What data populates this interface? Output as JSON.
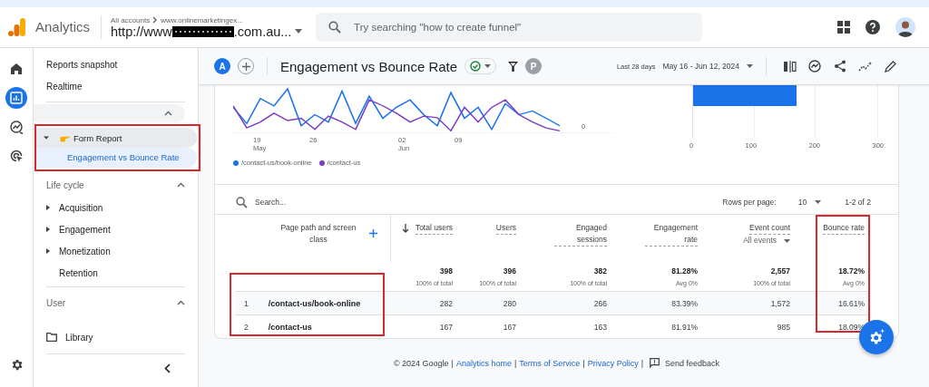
{
  "topbar": {
    "logo_text": "Analytics",
    "breadcrumb": [
      "All accounts",
      "www.onlinemarketingex..."
    ],
    "property": {
      "prefix": "http://www",
      "redacted": true,
      "suffix": ".com.au..."
    },
    "search": {
      "placeholder": "Try searching \"how to create funnel\""
    }
  },
  "rail": [
    {
      "selected": false
    },
    {
      "selected": true
    },
    {
      "selected": false
    },
    {
      "selected": false
    }
  ],
  "sidebar": {
    "top_items": [
      "Reports snapshot",
      "Realtime"
    ],
    "collection": {
      "expanded": true,
      "items": [
        {
          "label": "Form Report",
          "expanded": true,
          "highlighted": true,
          "children": [
            {
              "label": "Engagement vs Bounce Rate",
              "selected": true
            }
          ]
        }
      ]
    },
    "sections": [
      {
        "title": "Life cycle",
        "expanded": true,
        "items": [
          {
            "label": "Acquisition",
            "has_children": true
          },
          {
            "label": "Engagement",
            "has_children": true
          },
          {
            "label": "Monetization",
            "has_children": true
          },
          {
            "label": "Retention",
            "has_children": false
          }
        ]
      },
      {
        "title": "User",
        "expanded": true
      }
    ],
    "library": "Library"
  },
  "report": {
    "comparison": "A",
    "title": "Engagement vs Bounce Rate",
    "user": "P",
    "date_label": "Last 28 days",
    "date_range": "May 16 - Jun 12, 2024"
  },
  "line_chart": {
    "y_label": "0",
    "x_labels": [
      {
        "day": "19",
        "month": "May"
      },
      {
        "day": "26"
      },
      {
        "day": "02",
        "month": "Jun"
      },
      {
        "day": "09"
      }
    ],
    "legend": [
      {
        "label": "/contact-us/book-online",
        "color": "#1a73e8"
      },
      {
        "label": "/contact-us",
        "color": "#7b3fc4"
      }
    ]
  },
  "bar_chart": {
    "ticks": [
      "0",
      "100",
      "200",
      "300"
    ]
  },
  "table": {
    "search_placeholder": "Search...",
    "rows_per_page_label": "Rows per page:",
    "rows_per_page": "10",
    "range": "1-2 of 2",
    "path_rows_highlighted": true,
    "columns": [
      {
        "label": "Page path and screen class",
        "sorted": false,
        "highlighted": false
      },
      {
        "label": "Total users",
        "sorted": true,
        "highlighted": false
      },
      {
        "label": "Users",
        "sorted": false,
        "highlighted": false
      },
      {
        "label": "Engaged sessions",
        "sorted": false,
        "highlighted": false
      },
      {
        "label": "Engagement rate",
        "sorted": false,
        "highlighted": false
      },
      {
        "label": "Event count",
        "sub": "All events",
        "sorted": false,
        "highlighted": false
      },
      {
        "label": "Bounce rate",
        "sorted": false,
        "highlighted": true
      }
    ],
    "totals": [
      {
        "value": "398",
        "note": "100% of total"
      },
      {
        "value": "396",
        "note": "100% of total"
      },
      {
        "value": "382",
        "note": "100% of total"
      },
      {
        "value": "81.28%",
        "note": "Avg 0%"
      },
      {
        "value": "2,557",
        "note": "100% of total"
      },
      {
        "value": "18.72%",
        "note": "Avg 0%"
      }
    ],
    "rows": [
      {
        "index": "1",
        "cells": [
          "/contact-us/book-online",
          "282",
          "280",
          "266",
          "83.39%",
          "1,572",
          "16.61%"
        ]
      },
      {
        "index": "2",
        "cells": [
          "/contact-us",
          "167",
          "167",
          "163",
          "81.91%",
          "985",
          "18.09%"
        ]
      }
    ]
  },
  "footer": {
    "copyright": "© 2024 Google",
    "separator": "|",
    "links": [
      "Analytics home",
      "Terms of Service",
      "Privacy Policy"
    ],
    "feedback": "Send feedback"
  }
}
